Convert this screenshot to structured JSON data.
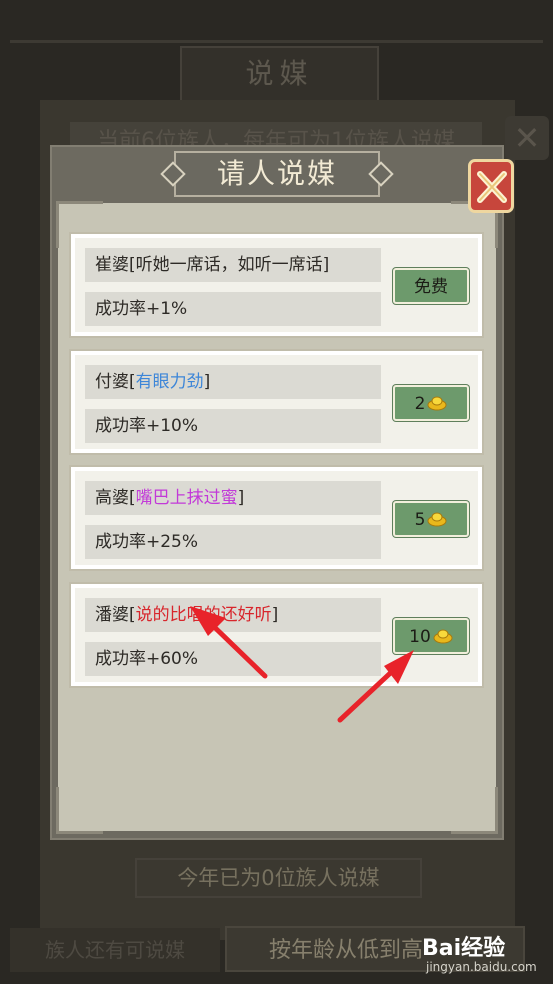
{
  "background": {
    "title": "说媒",
    "subtitle": "当前6位族人，每年可为1位族人说媒",
    "close_glyph": "✕",
    "count_text": "今年已为0位族人说媒",
    "bottom_left_text": "族人还有可说媒",
    "sort_button": "按年龄从低到高"
  },
  "dialog": {
    "title": "请人说媒",
    "close_icon": "close-x-icon",
    "options": [
      {
        "name": "崔婆",
        "quote": "听她一席话，如听一席话",
        "quote_color": "#2d2a26",
        "rate": "成功率+1%",
        "price": "免费",
        "currency_icon": ""
      },
      {
        "name": "付婆",
        "quote": "有眼力劲",
        "quote_color": "#3d86d8",
        "rate": "成功率+10%",
        "price": "2",
        "currency_icon": "gold-ingot-icon"
      },
      {
        "name": "高婆",
        "quote": "嘴巴上抹过蜜",
        "quote_color": "#c23ad8",
        "rate": "成功率+25%",
        "price": "5",
        "currency_icon": "gold-ingot-icon"
      },
      {
        "name": "潘婆",
        "quote": "说的比唱的还好听",
        "quote_color": "#d8262c",
        "rate": "成功率+60%",
        "price": "10",
        "currency_icon": "gold-ingot-icon"
      }
    ]
  },
  "annotations": {
    "arrow_color": "#e8232a"
  },
  "watermark": {
    "logo": "Bai经验",
    "site": "jingyan.baidu.com"
  }
}
